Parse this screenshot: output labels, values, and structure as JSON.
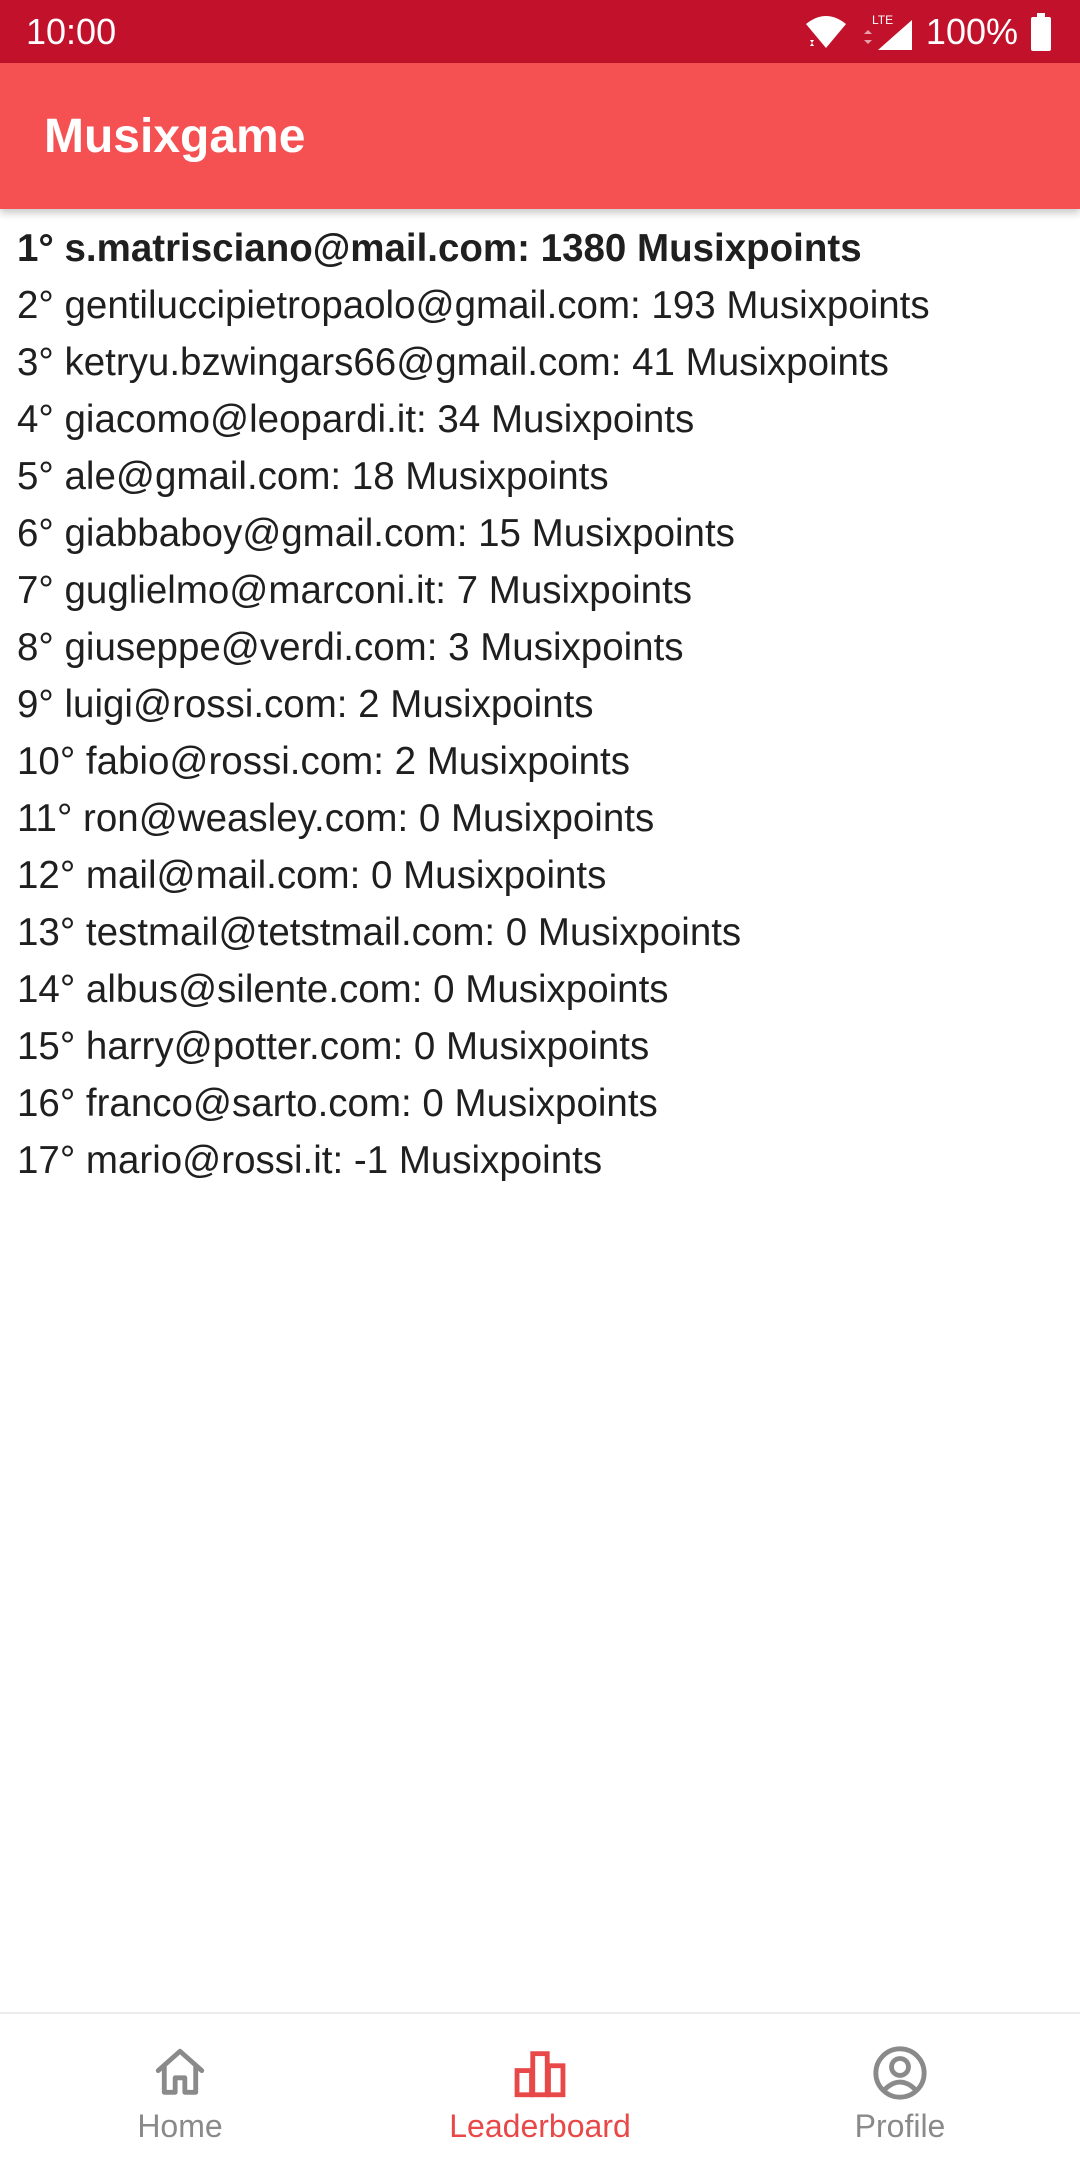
{
  "status_bar": {
    "time": "10:00",
    "network": "LTE",
    "battery": "100%",
    "icons": [
      "wifi-icon",
      "signal-icon",
      "battery-icon"
    ]
  },
  "app_bar": {
    "title": "Musixgame"
  },
  "leaderboard": {
    "rows": [
      "1° s.matrisciano@mail.com: 1380 Musixpoints",
      "2° gentiluccipietropaolo@gmail.com: 193 Musixpoints",
      "3° ketryu.bzwingars66@gmail.com: 41 Musixpoints",
      "4° giacomo@leopardi.it: 34 Musixpoints",
      "5° ale@gmail.com: 18 Musixpoints",
      "6° giabbaboy@gmail.com: 15 Musixpoints",
      "7° guglielmo@marconi.it: 7 Musixpoints",
      "8° giuseppe@verdi.com: 3 Musixpoints",
      "9° luigi@rossi.com: 2 Musixpoints",
      "10° fabio@rossi.com: 2 Musixpoints",
      "11° ron@weasley.com: 0 Musixpoints",
      "12° mail@mail.com: 0 Musixpoints",
      "13° testmail@tetstmail.com: 0 Musixpoints",
      "14° albus@silente.com: 0 Musixpoints",
      "15° harry@potter.com: 0 Musixpoints",
      "16° franco@sarto.com: 0 Musixpoints",
      "17° mario@rossi.it: -1 Musixpoints"
    ]
  },
  "bottom_nav": {
    "items": [
      {
        "label": "Home",
        "icon": "home-icon",
        "active": false
      },
      {
        "label": "Leaderboard",
        "icon": "leaderboard-icon",
        "active": true
      },
      {
        "label": "Profile",
        "icon": "profile-icon",
        "active": false
      }
    ]
  },
  "colors": {
    "status_bar": "#c2122b",
    "app_bar": "#f55153",
    "accent": "#e84848",
    "inactive": "#8a8a8a"
  }
}
